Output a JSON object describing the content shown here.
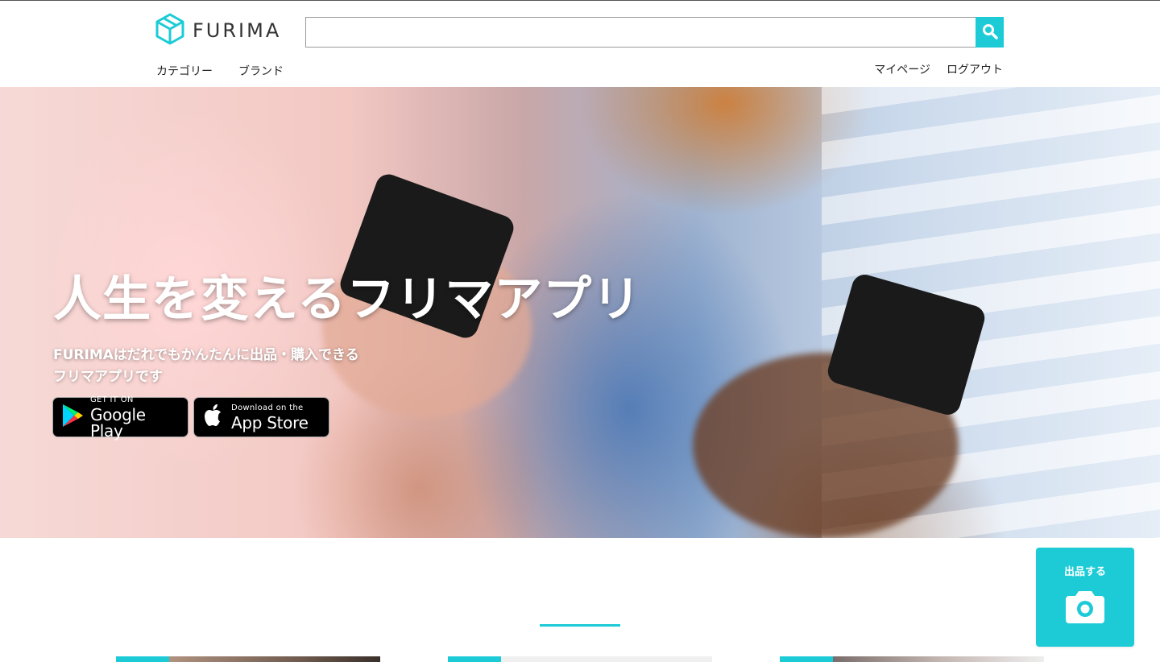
{
  "header": {
    "logo_text": "FURIMA",
    "search": {
      "value": "",
      "placeholder": ""
    },
    "nav_left": [
      "カテゴリー",
      "ブランド"
    ],
    "nav_right": [
      "マイページ",
      "ログアウト"
    ]
  },
  "hero": {
    "title": "人生を変えるフリマアプリ",
    "subtitle_line1": "FURIMAはだれでもかんたんに出品・購入できる",
    "subtitle_line2": "フリマアプリです",
    "google_play": {
      "small": "GET IT ON",
      "big": "Google Play"
    },
    "app_store": {
      "small": "Download on the",
      "big": "App Store"
    }
  },
  "sell_button": {
    "label": "出品する"
  },
  "colors": {
    "accent": "#1ccbd6"
  },
  "icons": {
    "search": "search-icon",
    "camera": "camera-icon",
    "logo": "cube-logo-icon",
    "play": "google-play-icon",
    "apple": "apple-icon"
  }
}
